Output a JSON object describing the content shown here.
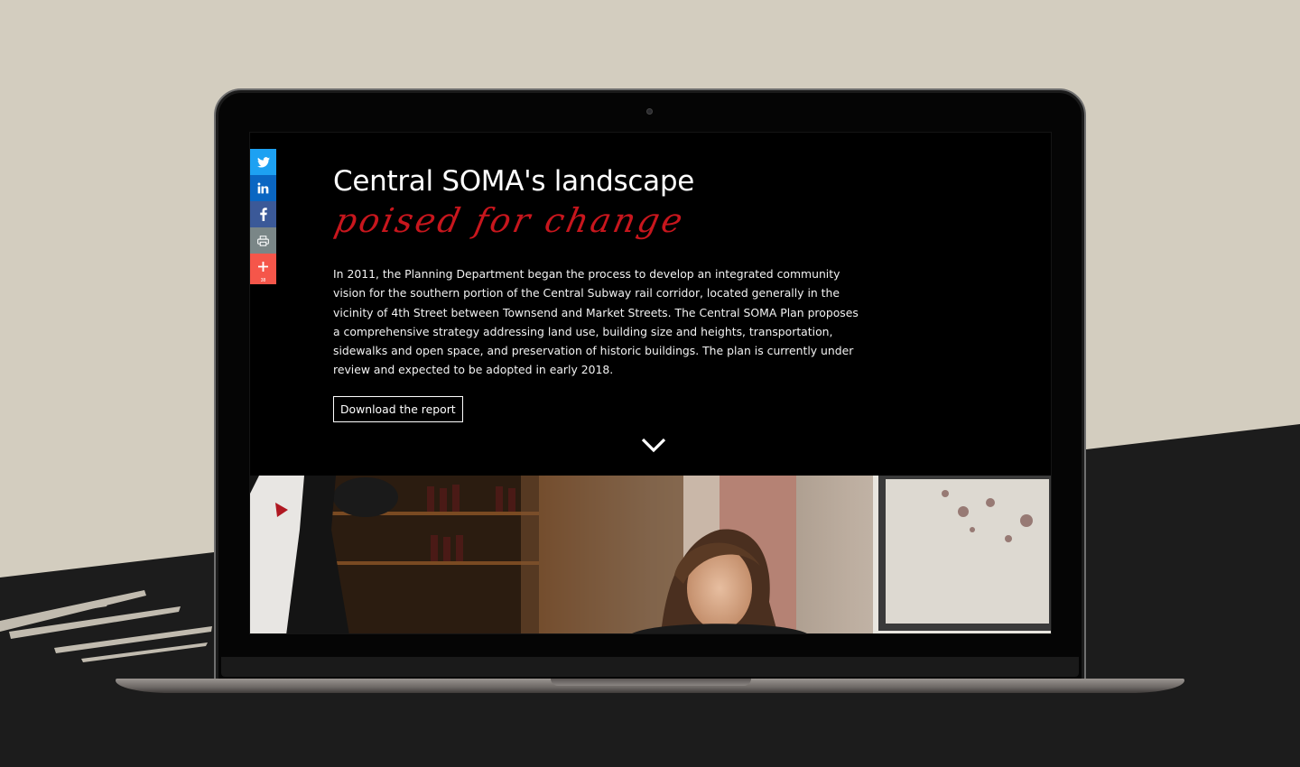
{
  "page": {
    "heading": "Central SOMA's landscape",
    "script_heading": "poised for change",
    "paragraph": "In 2011, the Planning Department began the process to develop an integrated community vision for the southern portion of the Central Subway rail corridor, located generally in the vicinity of 4th Street between Townsend and Market Streets. The Central SOMA Plan proposes a comprehensive strategy addressing land use, building size and heights, transportation, sidewalks and open space, and preservation of historic buildings. The plan is currently under review and expected to be adopted in early 2018.",
    "download_label": "Download the report"
  },
  "share": {
    "buttons": [
      {
        "icon": "twitter-icon",
        "color": "#1da1f2"
      },
      {
        "icon": "linkedin-icon",
        "color": "#0a66c2"
      },
      {
        "icon": "facebook-icon",
        "color": "#3b5998"
      },
      {
        "icon": "print-icon",
        "color": "#7a8687"
      },
      {
        "icon": "plus-icon",
        "color": "#f5564a"
      }
    ],
    "add_count": "38"
  },
  "colors": {
    "accent_red": "#c8161d",
    "background": "#d3cdbf",
    "screen": "#000000"
  }
}
